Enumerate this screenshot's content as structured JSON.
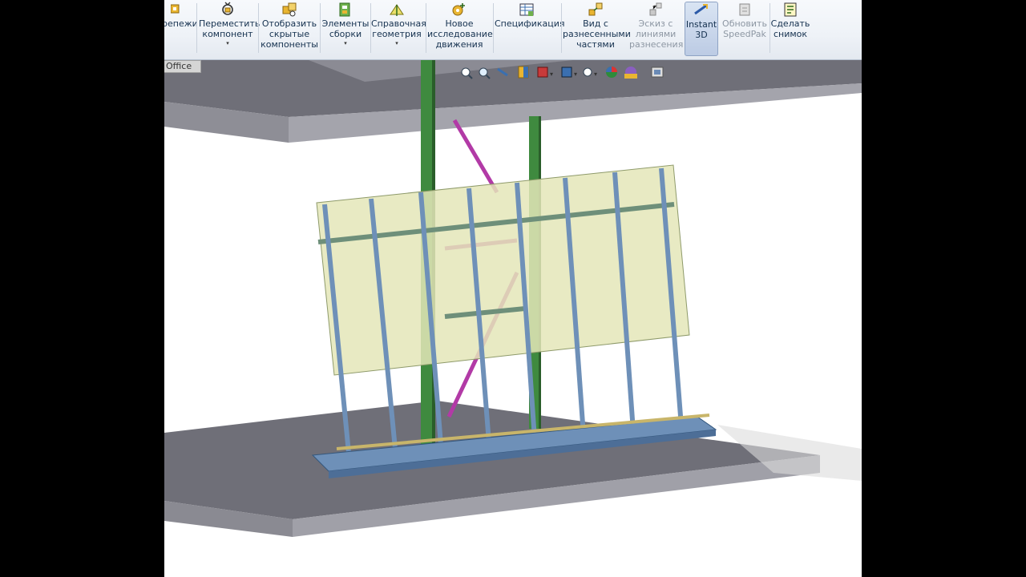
{
  "ribbon": {
    "buttons": [
      {
        "id": "fasteners",
        "label": "репежи",
        "icon": "fastener-icon",
        "dropdown": false,
        "state": "normal"
      },
      {
        "id": "move-component",
        "label": "Переместить\nкомпонент",
        "icon": "move-component-icon",
        "dropdown": true,
        "state": "normal"
      },
      {
        "id": "show-hidden",
        "label": "Отобразить\nскрытые\nкомпоненты",
        "icon": "show-hidden-icon",
        "dropdown": false,
        "state": "normal"
      },
      {
        "id": "assembly-features",
        "label": "Элементы\nсборки",
        "icon": "assembly-features-icon",
        "dropdown": true,
        "state": "normal"
      },
      {
        "id": "reference-geometry",
        "label": "Справочная\nгеометрия",
        "icon": "reference-geometry-icon",
        "dropdown": true,
        "state": "normal"
      },
      {
        "id": "motion-study",
        "label": "Новое\nисследование\nдвижения",
        "icon": "motion-study-icon",
        "dropdown": false,
        "state": "normal"
      },
      {
        "id": "bom",
        "label": "Спецификация",
        "icon": "bom-icon",
        "dropdown": false,
        "state": "normal"
      },
      {
        "id": "exploded-view",
        "label": "Вид с\nразнесенными\nчастями",
        "icon": "exploded-view-icon",
        "dropdown": false,
        "state": "normal"
      },
      {
        "id": "explode-line",
        "label": "Эскиз с\nлиниями\nразнесения",
        "icon": "explode-line-icon",
        "dropdown": false,
        "state": "disabled"
      },
      {
        "id": "instant3d",
        "label": "Instant\n3D",
        "icon": "instant3d-icon",
        "dropdown": false,
        "state": "active"
      },
      {
        "id": "speedpak",
        "label": "Обновить\nSpeedPak",
        "icon": "speedpak-icon",
        "dropdown": false,
        "state": "disabled"
      },
      {
        "id": "snapshot",
        "label": "Сделать\nснимок",
        "icon": "snapshot-icon",
        "dropdown": false,
        "state": "normal"
      }
    ]
  },
  "office_tab": {
    "label": "Office"
  },
  "heads_up_toolbar": {
    "icons": [
      "zoom-to-fit-icon",
      "zoom-area-icon",
      "previous-view-icon",
      "section-view-icon",
      "view-orientation-icon",
      "display-style-icon",
      "hide-show-icon",
      "edit-appearance-icon",
      "apply-scene-icon",
      "view-settings-icon"
    ]
  },
  "colors": {
    "ribbon_text": "#15314f",
    "panel_fill": "#e4e6b8",
    "frame_blue": "#6e90b8",
    "column_green": "#3f8a3f",
    "brace_magenta": "#b23aa6",
    "floor_top": "#6f6f78",
    "floor_side": "#9c9ca4"
  }
}
